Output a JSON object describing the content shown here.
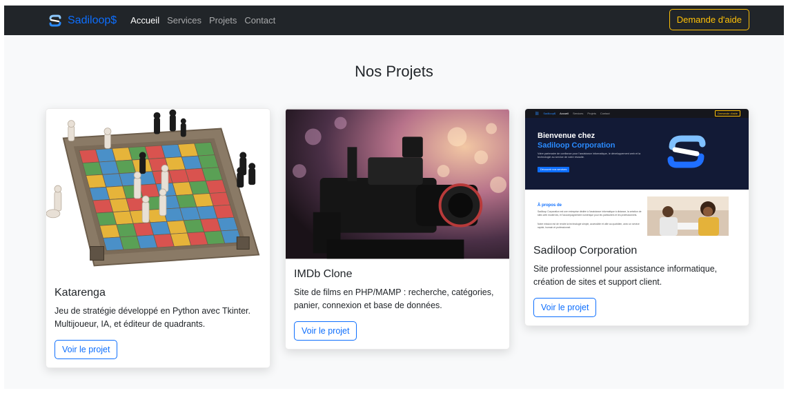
{
  "navbar": {
    "brand": "Sadiloop$",
    "links": [
      "Accueil",
      "Services",
      "Projets",
      "Contact"
    ],
    "help_button": "Demande d'aide"
  },
  "section": {
    "title": "Nos Projets"
  },
  "projects": [
    {
      "title": "Katarenga",
      "description": "Jeu de stratégie développé en Python avec Tkinter. Multijoueur, IA, et éditeur de quadrants.",
      "button": "Voir le projet"
    },
    {
      "title": "IMDb Clone",
      "description": "Site de films en PHP/MAMP : recherche, catégories, panier, connexion et base de données.",
      "button": "Voir le projet"
    },
    {
      "title": "Sadiloop Corporation",
      "description": "Site professionnel pour assistance informatique, création de sites et support client.",
      "button": "Voir le projet"
    }
  ],
  "mini_site": {
    "brand": "Sadiloop$",
    "links": [
      "Accueil",
      "Services",
      "Projets",
      "Contact"
    ],
    "help": "Demande d'aide",
    "hero_line1": "Bienvenue chez",
    "hero_line2": "Sadiloop Corporation",
    "hero_text": "Votre partenaire de confiance pour l'assistance informatique, le développement web et la technologie au service de votre réussite.",
    "hero_button": "Découvrir nos services",
    "about_title": "À propos de",
    "about_text": "Sadiloop Corporation est une entreprise dédiée à l'assistance informatique à distance, la création de sites web modernes, et l'accompagnement numérique pour les particuliers et les professionnels.",
    "about_text2": "Notre mission est de rendre la technologie simple, accessible et utile au quotidien, avec un service rapide, humain et professionnel."
  },
  "colors": {
    "primary": "#0d6efd",
    "warning": "#ffc107",
    "dark": "#212529"
  }
}
